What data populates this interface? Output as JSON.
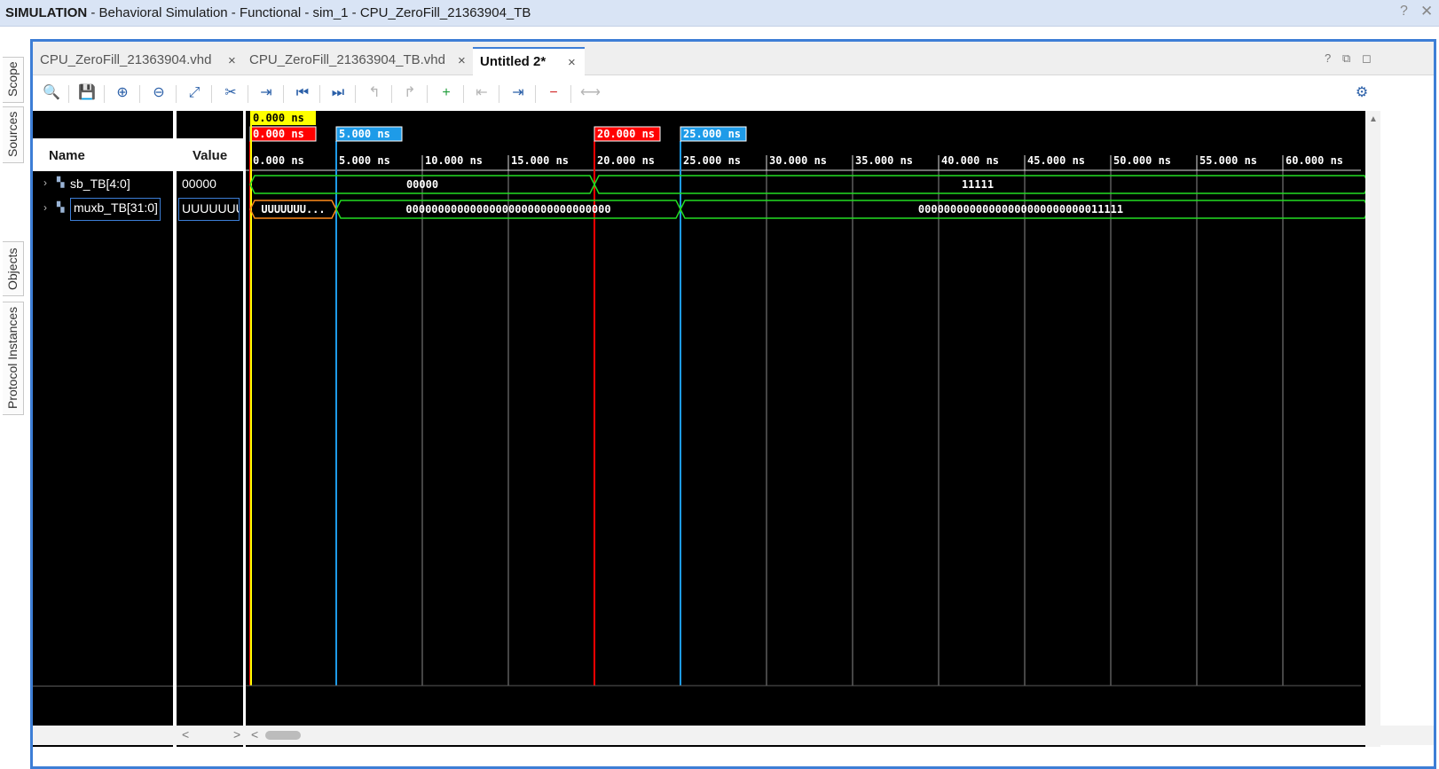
{
  "window": {
    "title_bold": "SIMULATION",
    "title_rest": " - Behavioral Simulation - Functional - sim_1 - CPU_ZeroFill_21363904_TB",
    "help": "?",
    "close": "✕"
  },
  "side_tabs": [
    "Scope",
    "Sources",
    "Objects",
    "Protocol Instances"
  ],
  "file_tabs": [
    {
      "label": "CPU_ZeroFill_21363904.vhd",
      "close": "×"
    },
    {
      "label": "CPU_ZeroFill_21363904_TB.vhd",
      "close": "×"
    },
    {
      "label": "Untitled 2*",
      "close": "×"
    }
  ],
  "panel_icons": {
    "help": "?",
    "restore": "⧉",
    "maximize": "◻"
  },
  "toolbar": [
    {
      "name": "search-icon",
      "glyph": "🔍",
      "enabled": true
    },
    {
      "name": "save-icon",
      "glyph": "💾",
      "enabled": true
    },
    {
      "name": "zoom-in-icon",
      "glyph": "⊕",
      "enabled": true
    },
    {
      "name": "zoom-out-icon",
      "glyph": "⊖",
      "enabled": true
    },
    {
      "name": "zoom-fit-icon",
      "glyph": "⤢",
      "enabled": true
    },
    {
      "name": "snap-cursor-icon",
      "glyph": "✂",
      "enabled": true
    },
    {
      "name": "goto-cursor-icon",
      "glyph": "⇥",
      "enabled": true
    },
    {
      "name": "goto-start-icon",
      "glyph": "⏮",
      "enabled": true
    },
    {
      "name": "goto-end-icon",
      "glyph": "⏭",
      "enabled": true
    },
    {
      "name": "prev-transition-icon",
      "glyph": "↰",
      "enabled": false
    },
    {
      "name": "next-transition-icon",
      "glyph": "↱",
      "enabled": false
    },
    {
      "name": "add-marker-icon",
      "glyph": "+",
      "enabled": true
    },
    {
      "name": "prev-marker-icon",
      "glyph": "⇤",
      "enabled": false
    },
    {
      "name": "next-marker-icon",
      "glyph": "⇥",
      "enabled": true
    },
    {
      "name": "delete-marker-icon",
      "glyph": "−",
      "enabled": true
    },
    {
      "name": "swap-cursors-icon",
      "glyph": "⟷",
      "enabled": false
    },
    {
      "name": "settings-gear-icon",
      "glyph": "⚙",
      "enabled": true
    }
  ],
  "columns": {
    "name": "Name",
    "value": "Value"
  },
  "signals": [
    {
      "name": "sb_TB[4:0]",
      "value": "00000",
      "selected": false
    },
    {
      "name": "muxb_TB[31:0]",
      "value": "UUUUUUUU",
      "selected": true
    }
  ],
  "waveform": {
    "timescale_unit": "ns",
    "ticks": [
      "0.000 ns",
      "5.000 ns",
      "10.000 ns",
      "15.000 ns",
      "20.000 ns",
      "25.000 ns",
      "30.000 ns",
      "35.000 ns",
      "40.000 ns",
      "45.000 ns",
      "50.000 ns",
      "55.000 ns",
      "60.000 ns"
    ],
    "tick_values_ns": [
      0,
      5,
      10,
      15,
      20,
      25,
      30,
      35,
      40,
      45,
      50,
      55,
      60
    ],
    "cursor": {
      "label": "0.000 ns",
      "time_ns": 0,
      "color": "#ffff00"
    },
    "markers": [
      {
        "label": "0.000 ns",
        "time_ns": 0,
        "color": "#ff0000"
      },
      {
        "label": "5.000 ns",
        "time_ns": 5,
        "color": "#1e9be8"
      },
      {
        "label": "20.000 ns",
        "time_ns": 20,
        "color": "#ff0000"
      },
      {
        "label": "25.000 ns",
        "time_ns": 25,
        "color": "#1e9be8"
      }
    ],
    "traces": [
      {
        "signal": "sb_TB[4:0]",
        "segments": [
          {
            "from_ns": 0,
            "to_ns": 20,
            "text": "00000",
            "color": "#22dd22"
          },
          {
            "from_ns": 20,
            "to_ns": 65,
            "text": "11111",
            "color": "#22dd22"
          }
        ]
      },
      {
        "signal": "muxb_TB[31:0]",
        "segments": [
          {
            "from_ns": 0,
            "to_ns": 5,
            "text": "UUUUUUU...",
            "color": "#ff8c1a"
          },
          {
            "from_ns": 5,
            "to_ns": 25,
            "text": "00000000000000000000000000000000",
            "color": "#22dd22"
          },
          {
            "from_ns": 25,
            "to_ns": 65,
            "text": "00000000000000000000000000011111",
            "color": "#22dd22"
          }
        ]
      }
    ]
  },
  "scroll": {
    "left": "<",
    "right": ">"
  }
}
